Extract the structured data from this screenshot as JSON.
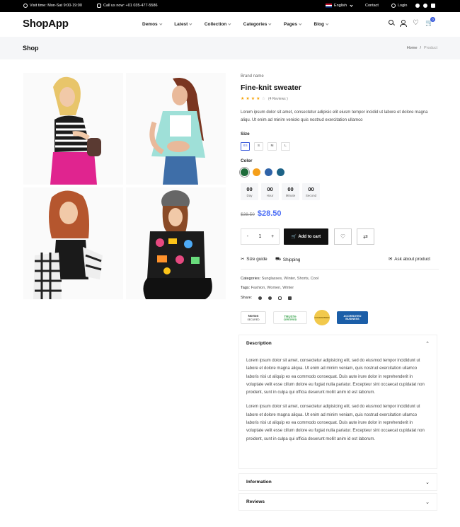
{
  "topbar": {
    "visit_time": "Visit time: Mon-Sat 9:00-19:00",
    "call": "Call us now: +01 035-477-5586",
    "language": "English",
    "contact": "Contact",
    "login": "Login"
  },
  "header": {
    "logo": "ShopApp",
    "nav": [
      "Demos",
      "Latest",
      "Collection",
      "Categories",
      "Pages",
      "Blog"
    ],
    "cart_count": "0"
  },
  "page": {
    "title": "Shop",
    "breadcrumb": [
      "Home",
      "Product"
    ]
  },
  "product": {
    "brand": "Brand name",
    "title": "Fine-knit sweater",
    "rating": 4,
    "rating_max": 5,
    "reviews": "(4 Reviews )",
    "description": "Lorem ipsum dolor sit amet, consectetur adipisic elit eiusm tempor incidid ut labore et dolore magna aliqu. Ut enim ad minim veniolo quis nostrud exercitation ullamco",
    "size_label": "Size",
    "sizes": [
      "XS",
      "S",
      "M",
      "L"
    ],
    "selected_size": "XS",
    "color_label": "Color",
    "colors": [
      "#1e6b3a",
      "#f59f1a",
      "#2f63a8",
      "#1d6387"
    ],
    "countdown": [
      {
        "value": "00",
        "unit": "Day"
      },
      {
        "value": "00",
        "unit": "Hour"
      },
      {
        "value": "00",
        "unit": "Minute"
      },
      {
        "value": "00",
        "unit": "Second"
      }
    ],
    "old_price": "$38.50",
    "price": "$28.50",
    "quantity": "1",
    "qty_minus": "-",
    "qty_plus": "+",
    "add_to_cart": "Add to cart",
    "size_guide": "Size guide",
    "shipping": "Shipping",
    "ask": "Ask about product",
    "categories_label": "Categories:",
    "categories": "Sunglasses, Winter, Shorts, Cool",
    "tags_label": "Tags:",
    "tags": "Fashion, Women, Winter",
    "share_label": "Share:",
    "trust_badges": [
      {
        "name": "Norton",
        "sub": "SECURED"
      },
      {
        "name": "TRUSTe",
        "sub": "CERTIFIED"
      },
      {
        "name": "GUARANTEED",
        "sub": ""
      },
      {
        "name": "ACCREDITED",
        "sub": "BUSINESS"
      }
    ]
  },
  "tabs": {
    "description_title": "Description",
    "description_p1": "Lorem ipsum dolor sit amet, consectetur adipisicing elit, sed do eiusmod tempor incididunt ut labore et dolore magna aliqua. Ut enim ad minim veniam, quis nostrud exercitation ullamco laboris nisi ut aliquip ex ea commodo consequat. Duis aute irure dolor in reprehenderit in voluptate velit esse cillum dolore eu fugiat nulla pariatur. Excepteur sint occaecat cupidatat non proident, sunt in culpa qui officia deserunt mollit anim id est laborum.",
    "description_p2": "Lorem ipsum dolor sit amet, consectetur adipisicing elit, sed do eiusmod tempor incididunt ut labore et dolore magna aliqua. Ut enim ad minim veniam, quis nostrud exercitation ullamco laboris nisi ut aliquip ex ea commodo consequat. Duis aute irure dolor in reprehenderit in voluptate velit esse cillum dolore eu fugiat nulla pariatur. Excepteur sint occaecat cupidatat non proident, sunt in culpa qui officia deserunt mollit anim id est laborum.",
    "information_title": "Information",
    "reviews_title": "Reviews"
  }
}
